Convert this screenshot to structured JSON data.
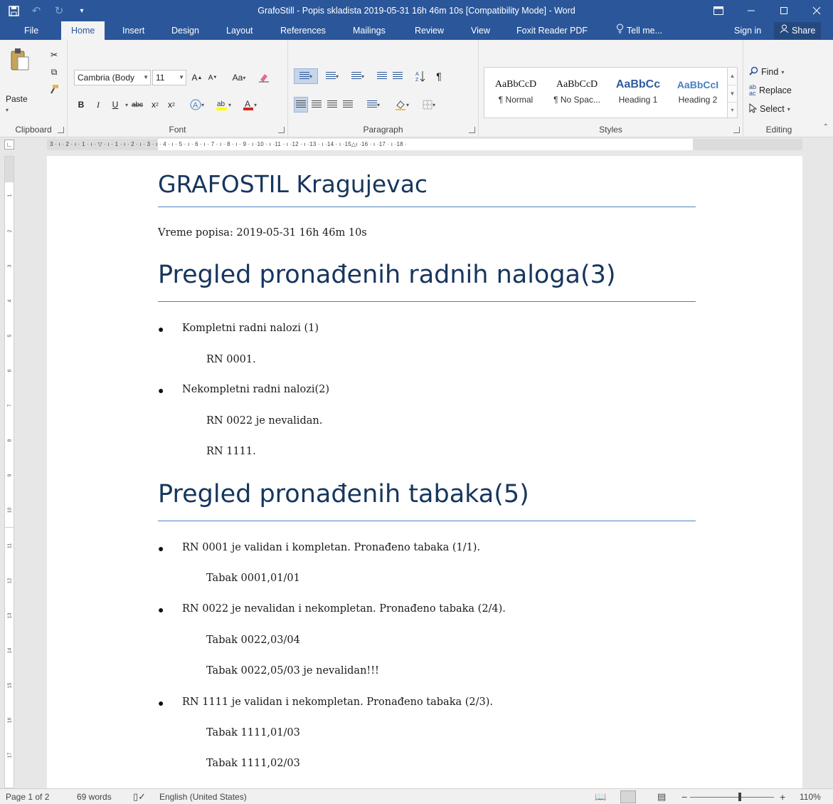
{
  "window": {
    "title": "GrafoStill - Popis skladista 2019-05-31 16h 46m 10s [Compatibility Mode] - Word"
  },
  "tabs": {
    "file": "File",
    "home": "Home",
    "insert": "Insert",
    "design": "Design",
    "layout": "Layout",
    "references": "References",
    "mailings": "Mailings",
    "review": "Review",
    "view": "View",
    "foxit": "Foxit Reader PDF",
    "tell_me": "Tell me...",
    "sign_in": "Sign in",
    "share": "Share"
  },
  "ribbon": {
    "clipboard": {
      "paste": "Paste",
      "label": "Clipboard"
    },
    "font": {
      "name": "Cambria (Body",
      "size": "11",
      "change_case": "Aa",
      "bold": "B",
      "italic": "I",
      "underline": "U",
      "strike": "abc",
      "subscript": "x",
      "superscript": "x",
      "label": "Font"
    },
    "paragraph": {
      "label": "Paragraph"
    },
    "styles": {
      "items": [
        {
          "sample": "AaBbCcD",
          "name": "¶ Normal"
        },
        {
          "sample": "AaBbCcD",
          "name": "¶ No Spac..."
        },
        {
          "sample": "AaBbCc",
          "name": "Heading 1"
        },
        {
          "sample": "AaBbCcI",
          "name": "Heading 2"
        }
      ],
      "label": "Styles"
    },
    "editing": {
      "find": "Find",
      "replace": "Replace",
      "select": "Select",
      "label": "Editing"
    }
  },
  "ruler": {
    "h_numbers": "3 · ı · 2 · ı · 1 · ı · ▽ · ı · 1 · ı · 2 · ı · 3 · ı · 4 · ı · 5 · ı · 6 · ı · 7 · ı · 8 · ı · 9 · ı ·10 · ı ·11 · ı ·12 · ı ·13 · ı ·14 · ı ·15△ı ·16 · ı ·17 · ı ·18 ·",
    "v_numbers": [
      "1",
      "2",
      "3",
      "4",
      "5",
      "6",
      "7",
      "8",
      "9",
      "10",
      "11",
      "12",
      "13",
      "14",
      "15",
      "16",
      "17"
    ]
  },
  "document": {
    "title": "GRAFOSTIL Kragujevac",
    "timestamp": "Vreme popisa: 2019-05-31 16h 46m 10s",
    "section1": {
      "heading": "Pregled pronađenih radnih naloga(3)",
      "b1": "Kompletni radni nalozi (1)",
      "b1_sub1": "RN 0001.",
      "b2": "Nekompletni radni nalozi(2)",
      "b2_sub1": "RN 0022 je nevalidan.",
      "b2_sub2": "RN 1111."
    },
    "section2": {
      "heading": "Pregled pronađenih tabaka(5)",
      "b1": "RN 0001 je validan i kompletan. Pronađeno tabaka (1/1).",
      "b1_sub1": "Tabak 0001,01/01",
      "b2": "RN 0022 je nevalidan i nekompletan. Pronađeno tabaka (2/4).",
      "b2_sub1": "Tabak 0022,03/04",
      "b2_sub2": "Tabak 0022,05/03 je nevalidan!!!",
      "b3": "RN 1111 je validan i nekompletan. Pronađeno tabaka (2/3).",
      "b3_sub1": "Tabak 1111,01/03",
      "b3_sub2": "Tabak 1111,02/03"
    }
  },
  "status": {
    "page": "Page 1 of 2",
    "words": "69 words",
    "language": "English (United States)",
    "zoom": "110%"
  },
  "colors": {
    "accent": "#2b579a",
    "heading": "#17365d",
    "rule": "#4f81bd"
  }
}
